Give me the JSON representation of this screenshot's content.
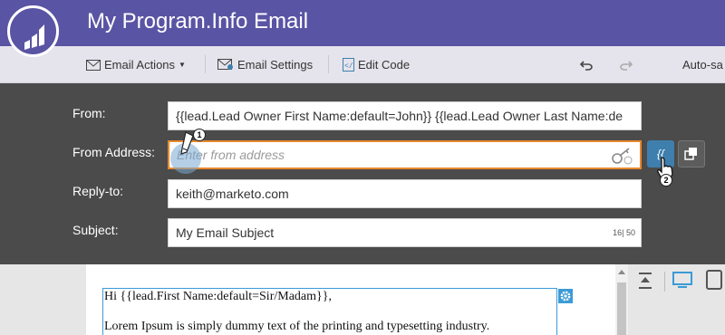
{
  "header": {
    "title": "My Program.Info Email"
  },
  "toolbar": {
    "email_actions": "Email Actions",
    "email_settings": "Email Settings",
    "edit_code": "Edit Code",
    "autosave": "Auto-sa"
  },
  "form": {
    "from": {
      "label": "From:",
      "value": "{{lead.Lead Owner First Name:default=John}} {{lead.Lead Owner Last Name:de"
    },
    "from_address": {
      "label": "From Address:",
      "placeholder": "Enter from address"
    },
    "reply_to": {
      "label": "Reply-to:",
      "value": "keith@marketo.com"
    },
    "subject": {
      "label": "Subject:",
      "value": "My Email Subject",
      "counter": "16| 50"
    }
  },
  "token_button": {
    "label": "{{"
  },
  "callouts": {
    "one": "1",
    "two": "2"
  },
  "body": {
    "line1": "Hi {{lead.First Name:default=Sir/Madam}},",
    "line2": "Lorem Ipsum is simply dummy text of the printing and typesetting industry."
  },
  "colors": {
    "header": "#5a54a4",
    "panel": "#4b4b4b",
    "accent": "#3f7fae",
    "focus": "#e8892e"
  }
}
